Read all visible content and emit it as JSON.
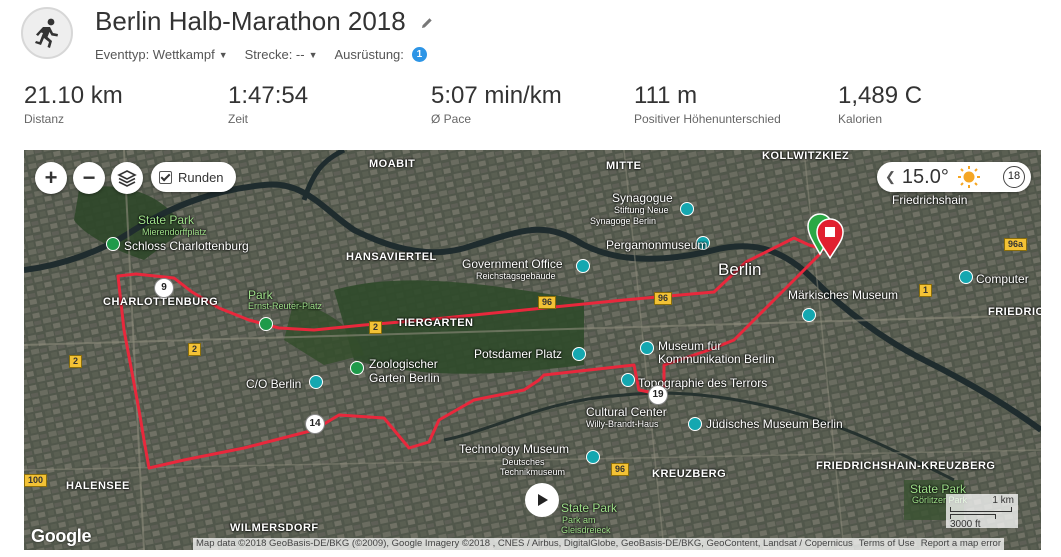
{
  "activity": {
    "title": "Berlin Halb-Marathon 2018",
    "icon": "runner-icon",
    "event_type_label": "Eventtyp: Wettkampf",
    "course_label": "Strecke: --",
    "gear_label": "Ausrüstung:",
    "gear_count": "1"
  },
  "stats": [
    {
      "value": "21.10 km",
      "label": "Distanz"
    },
    {
      "value": "1:47:54",
      "label": "Zeit"
    },
    {
      "value": "5:07 min/km",
      "label": "Ø Pace"
    },
    {
      "value": "111 m",
      "label": "Positiver Höhenunterschied"
    },
    {
      "value": "1,489 C",
      "label": "Kalorien"
    }
  ],
  "map": {
    "zoom_in": "+",
    "zoom_out": "−",
    "laps_label": "Runden",
    "laps_checked": true,
    "temperature": "15.0°",
    "wind_speed": "18",
    "weather_icon": "sun-icon",
    "google_logo": "Google",
    "attribution": "Map data ©2018 GeoBasis-DE/BKG (©2009), Google Imagery ©2018 , CNES / Airbus, DigitalGlobe, GeoBasis-DE/BKG, GeoContent, Landsat / Copernicus",
    "terms": "Terms of Use",
    "report": "Report a map error",
    "scale_km": "1 km",
    "scale_ft": "3000 ft",
    "km_markers": [
      "9",
      "14",
      "19"
    ],
    "labels": {
      "moabit": "MOABIT",
      "mitte": "MITTE",
      "kollwitzkiez": "KOLLWITZKIEZ",
      "hansaviertel": "HANSAVIERTEL",
      "tiergarten": "TIERGARTEN",
      "charlottenburg": "CHARLOTTENBURG",
      "halensee": "HALENSEE",
      "wilmersdorf": "WILMERSDORF",
      "kreuzberg": "KREUZBERG",
      "friedrichshain_kreuzberg": "FRIEDRICHSHAIN-KREUZBERG",
      "friedrichshain": "Friedrichshain",
      "friedric": "FRIEDRIC",
      "berlin": "Berlin",
      "state_park_1": "State Park",
      "mierendorffplatz": "Mierendorffplatz",
      "schloss": "Schloss Charlottenburg",
      "park_ernst": "Park",
      "ernst_reuter": "Ernst-Reuter-Platz",
      "government_office": "Government Office",
      "reichstag": "Reichstagsgebäude",
      "synagogue": "Synagogue",
      "stiftung": "Stiftung Neue",
      "synagoge": "Synagoge Berlin",
      "pergamon": "Pergamonmuseum",
      "maerkisches": "Märkisches Museum",
      "computer": "Computer",
      "potsdamer": "Potsdamer Platz",
      "zoo1": "Zoologischer",
      "zoo2": "Garten Berlin",
      "co_berlin": "C/O Berlin",
      "museum_fuer": "Museum für",
      "kommunikation": "Kommunikation Berlin",
      "topographie": "Topographie des Terrors",
      "cultural": "Cultural Center",
      "willy": "Willy-Brandt-Haus",
      "juedisches": "Jüdisches Museum Berlin",
      "technology": "Technology Museum",
      "deutsches": "Deutsches",
      "technikmuseum": "Technikmuseum",
      "state_park_2": "State Park",
      "park_am": "Park am",
      "gleisdreieck": "Gleisdreieck",
      "state_park_3": "State Park",
      "goerlitzer": "Görlitzer Park"
    },
    "roads": [
      "2",
      "96",
      "2",
      "96",
      "96a",
      "1",
      "2",
      "100",
      "96"
    ]
  },
  "colors": {
    "route": "#e8283c",
    "start": "#2aa845",
    "end": "#e1202f",
    "badge": "#2d95e6"
  }
}
